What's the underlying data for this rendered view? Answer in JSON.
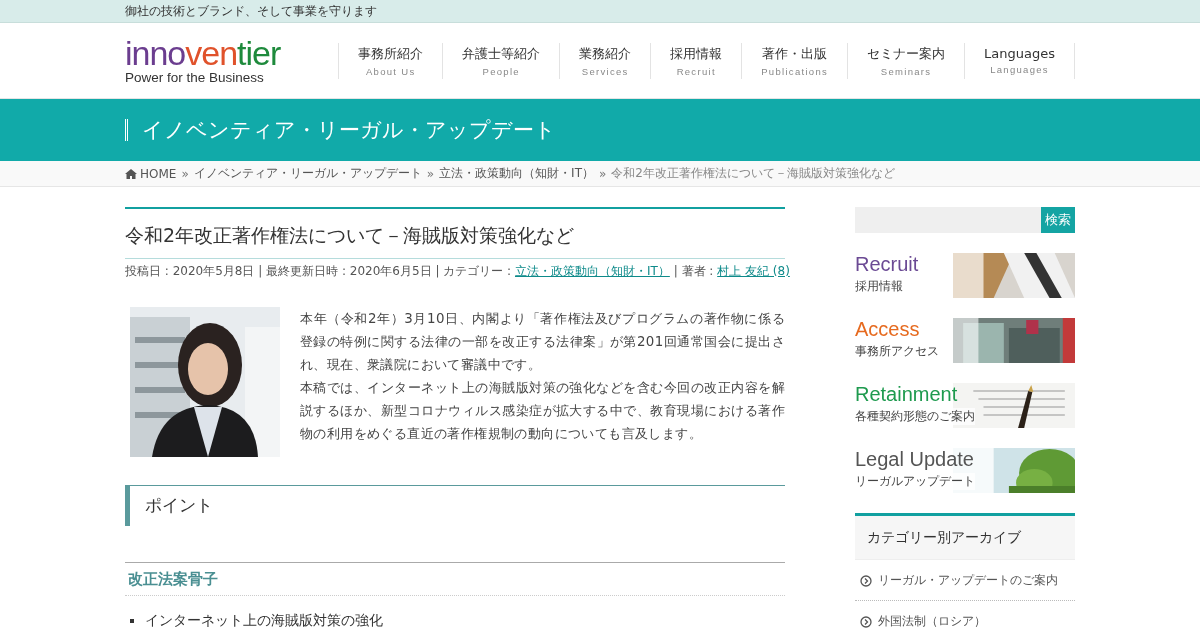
{
  "tagline": "御社の技術とブランド、そして事業を守ります",
  "logo": {
    "parts": [
      {
        "text": "inno",
        "color": "#6b3d8f"
      },
      {
        "text": "ven",
        "color": "#e0522b"
      },
      {
        "text": "tier",
        "color": "#1e8a3c"
      }
    ],
    "slogan": "Power for the Business"
  },
  "nav": [
    {
      "label": "事務所紹介",
      "sub": "About Us"
    },
    {
      "label": "弁護士等紹介",
      "sub": "People"
    },
    {
      "label": "業務紹介",
      "sub": "Services"
    },
    {
      "label": "採用情報",
      "sub": "Recruit"
    },
    {
      "label": "著作・出版",
      "sub": "Publications"
    },
    {
      "label": "セミナー案内",
      "sub": "Seminars"
    },
    {
      "label": "Languages",
      "sub": "Languages"
    }
  ],
  "page_title": "イノベンティア・リーガル・アップデート",
  "breadcrumb": {
    "items": [
      "HOME",
      "イノベンティア・リーガル・アップデート",
      "立法・政策動向（知財・IT）"
    ],
    "current": "令和2年改正著作権法について－海賊版対策強化など",
    "separator": "»"
  },
  "article": {
    "title": "令和2年改正著作権法について－海賊版対策強化など",
    "meta": [
      {
        "label": "投稿日 : 2020年5月8日 | 最終更新日時 : 2020年6月5日 | カテゴリー : "
      },
      {
        "link": "立法・政策動向（知財・IT）"
      },
      {
        "label": " | 著者 : "
      },
      {
        "link": "村上 友紀 (8)"
      }
    ],
    "image": {
      "kind": "picture"
    },
    "paragraphs": [
      "本年（令和2年）3月10日、内閣より「著作権法及びプログラムの著作物に係る登録の特例に関する法律の一部を改正する法律案」が第201回通常国会に提出され、現在、衆議院において審議中です。",
      "本稿では、インターネット上の海賊版対策の強化などを含む今回の改正内容を解説するほか、新型コロナウィルス感染症が拡大する中で、教育現場における著作物の利用をめぐる直近の著作権規制の動向についても言及します。"
    ],
    "point_heading": "ポイント",
    "section_heading": "改正法案骨子",
    "bullets": [
      "インターネット上の海賊版対策の強化"
    ]
  },
  "search": {
    "button": "検索"
  },
  "banners": [
    {
      "title": "Recruit",
      "subtitle": "採用情報",
      "color": "#6b4a94",
      "kind": "suit"
    },
    {
      "title": "Access",
      "subtitle": "事務所アクセス",
      "color": "#e66a1f",
      "kind": "building"
    },
    {
      "title": "Retainment",
      "subtitle": "各種契約形態のご案内",
      "color": "#1e9a4e",
      "kind": "pen"
    },
    {
      "title": "Legal Update",
      "subtitle": "リーガルアップデート",
      "color": "#555555",
      "kind": "tree"
    }
  ],
  "archive": {
    "heading": "カテゴリー別アーカイブ",
    "items": [
      "リーガル・アップデートのご案内",
      "外国法制（ロシア）"
    ]
  }
}
